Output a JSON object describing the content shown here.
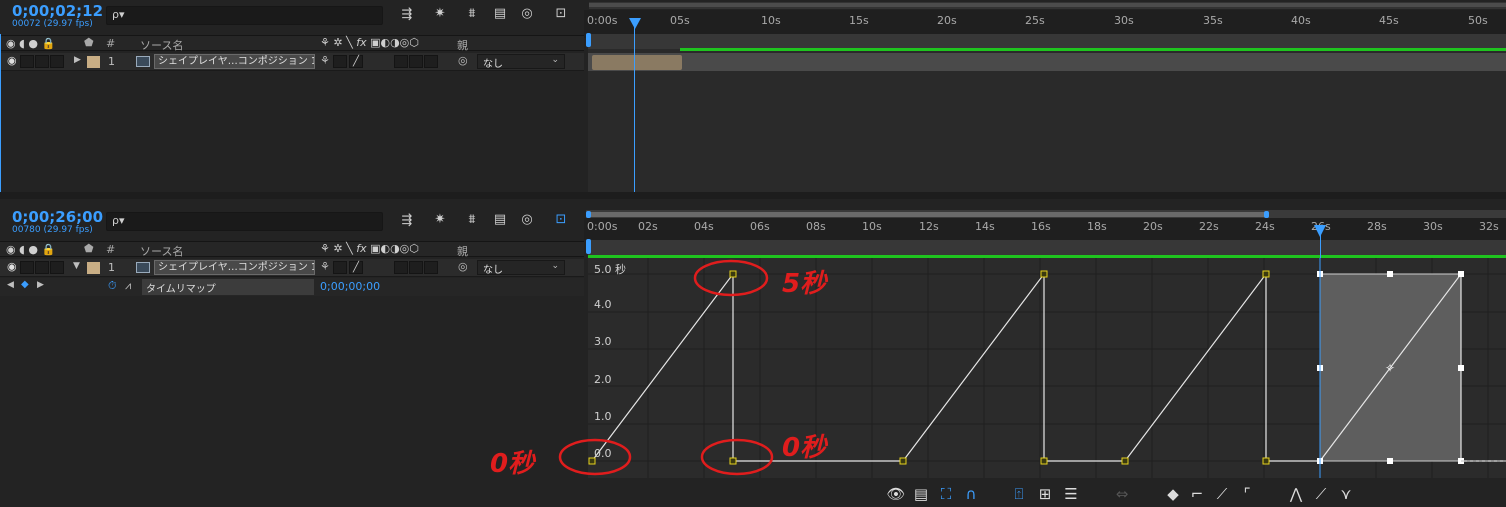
{
  "panel1": {
    "timecode": "0;00;02;12",
    "frames": "00072 (29.97 fps)",
    "search_placeholder": "ρ▾",
    "ticks": [
      "0:00s",
      "05s",
      "10s",
      "15s",
      "20s",
      "25s",
      "30s",
      "35s",
      "40s",
      "45s",
      "50s"
    ],
    "header": {
      "source_name": "ソース名",
      "parent": "親",
      "number": "#",
      "fx": "fx"
    },
    "layer": {
      "index": "1",
      "name": "シェイプレイヤ…コンポジション 1",
      "parent": "なし"
    }
  },
  "panel2": {
    "timecode": "0;00;26;00",
    "frames": "00780 (29.97 fps)",
    "search_placeholder": "ρ▾",
    "ticks": [
      "0:00s",
      "02s",
      "04s",
      "06s",
      "08s",
      "10s",
      "12s",
      "14s",
      "16s",
      "18s",
      "20s",
      "22s",
      "24s",
      "26s",
      "28s",
      "30s",
      "32s"
    ],
    "header": {
      "source_name": "ソース名",
      "parent": "親",
      "number": "#",
      "fx": "fx"
    },
    "layer": {
      "index": "1",
      "name": "シェイプレイヤ…コンポジション 1",
      "parent": "なし"
    },
    "property": {
      "name": "タイムリマップ",
      "value": "0;00;00;00"
    },
    "graph_labels": [
      "5.0 秒",
      "4.0",
      "3.0",
      "2.0",
      "1.0",
      "0.0"
    ]
  },
  "annotations": {
    "five": "5秒",
    "zero_left": "0秒",
    "zero_mid": "0秒"
  },
  "colors": {
    "accent": "#3b9eff",
    "green": "#1fc41f",
    "annotation": "#e01d1d"
  }
}
